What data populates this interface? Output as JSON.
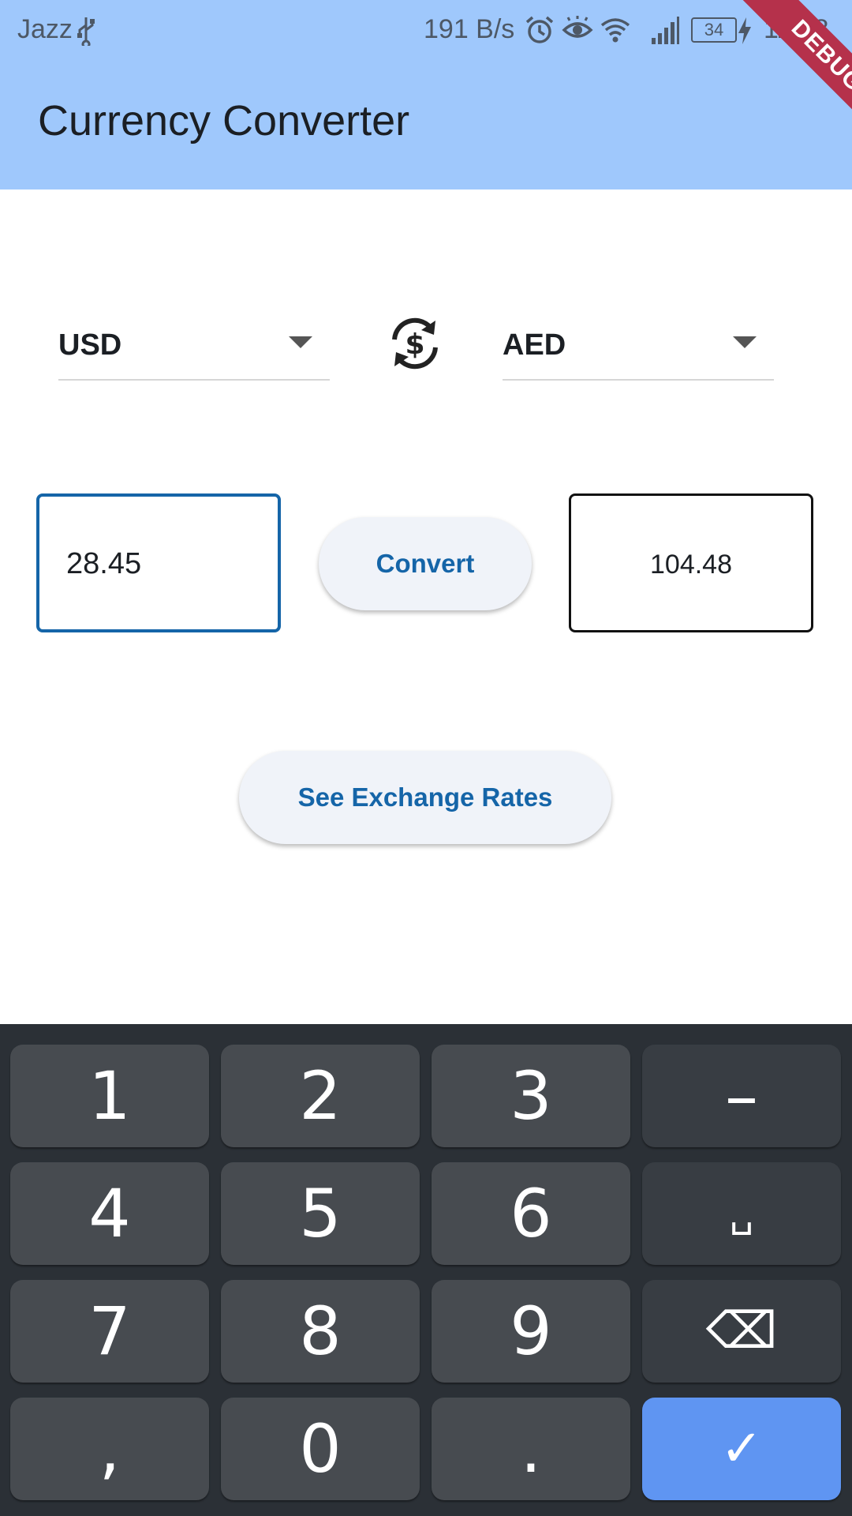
{
  "status_bar": {
    "carrier": "Jazz",
    "net_speed": "191 B/s",
    "battery": "34",
    "time": "11:38",
    "icons": [
      "usb-icon",
      "alarm-icon",
      "eye-icon",
      "wifi-icon",
      "signal-icon",
      "battery-icon",
      "charging-icon"
    ]
  },
  "app_bar": {
    "title": "Currency Converter",
    "debug_banner": "DEBUG"
  },
  "converter": {
    "from_currency": "USD",
    "to_currency": "AED",
    "amount": "28.45",
    "result": "104.48",
    "convert_label": "Convert",
    "rates_label": "See Exchange Rates"
  },
  "keyboard": {
    "keys": [
      "1",
      "2",
      "3",
      "–",
      "4",
      "5",
      "6",
      "␣",
      "7",
      "8",
      "9",
      "⌫",
      ",",
      "0",
      ".",
      "✓"
    ]
  },
  "colors": {
    "app_bar": "#9fc8fc",
    "accent": "#1565a8",
    "button_bg": "#f0f3f9",
    "keyboard_bg": "#2b3036",
    "key_bg": "#474b50",
    "confirm_key": "#5f95f2"
  }
}
